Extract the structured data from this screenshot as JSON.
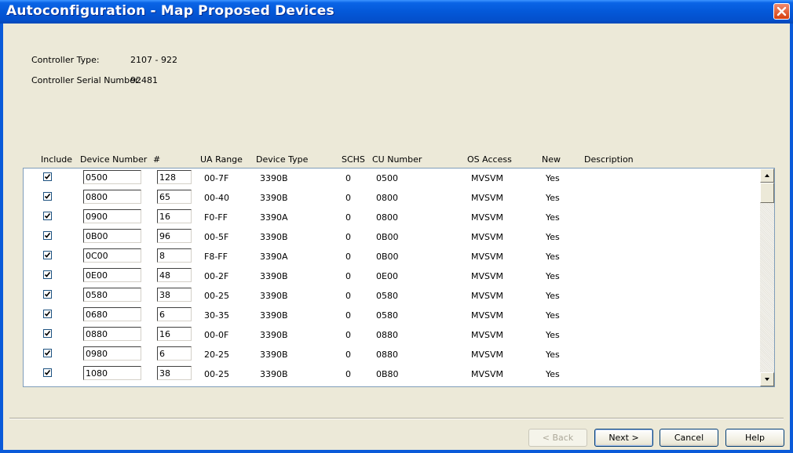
{
  "window": {
    "title": "Autoconfiguration - Map Proposed Devices"
  },
  "info": {
    "controller_type_label": "Controller Type:",
    "controller_type_value": "2107 - 922",
    "serial_label": "Controller Serial Number:",
    "serial_value": "92481"
  },
  "columns": {
    "include": "Include",
    "device_number": "Device Number",
    "count": "#",
    "ua_range": "UA Range",
    "device_type": "Device Type",
    "schs": "SCHS",
    "cu_number": "CU Number",
    "os_access": "OS Access",
    "new": "New",
    "description": "Description"
  },
  "rows": [
    {
      "include": true,
      "device_number": "0500",
      "count": "128",
      "ua_range": "00-7F",
      "device_type": "3390B",
      "schs": "0",
      "cu_number": "0500",
      "os_access": "MVSVM",
      "new": "Yes",
      "description": ""
    },
    {
      "include": true,
      "device_number": "0800",
      "count": "65",
      "ua_range": "00-40",
      "device_type": "3390B",
      "schs": "0",
      "cu_number": "0800",
      "os_access": "MVSVM",
      "new": "Yes",
      "description": ""
    },
    {
      "include": true,
      "device_number": "0900",
      "count": "16",
      "ua_range": "F0-FF",
      "device_type": "3390A",
      "schs": "0",
      "cu_number": "0800",
      "os_access": "MVSVM",
      "new": "Yes",
      "description": ""
    },
    {
      "include": true,
      "device_number": "0B00",
      "count": "96",
      "ua_range": "00-5F",
      "device_type": "3390B",
      "schs": "0",
      "cu_number": "0B00",
      "os_access": "MVSVM",
      "new": "Yes",
      "description": ""
    },
    {
      "include": true,
      "device_number": "0C00",
      "count": "8",
      "ua_range": "F8-FF",
      "device_type": "3390A",
      "schs": "0",
      "cu_number": "0B00",
      "os_access": "MVSVM",
      "new": "Yes",
      "description": ""
    },
    {
      "include": true,
      "device_number": "0E00",
      "count": "48",
      "ua_range": "00-2F",
      "device_type": "3390B",
      "schs": "0",
      "cu_number": "0E00",
      "os_access": "MVSVM",
      "new": "Yes",
      "description": ""
    },
    {
      "include": true,
      "device_number": "0580",
      "count": "38",
      "ua_range": "00-25",
      "device_type": "3390B",
      "schs": "0",
      "cu_number": "0580",
      "os_access": "MVSVM",
      "new": "Yes",
      "description": ""
    },
    {
      "include": true,
      "device_number": "0680",
      "count": "6",
      "ua_range": "30-35",
      "device_type": "3390B",
      "schs": "0",
      "cu_number": "0580",
      "os_access": "MVSVM",
      "new": "Yes",
      "description": ""
    },
    {
      "include": true,
      "device_number": "0880",
      "count": "16",
      "ua_range": "00-0F",
      "device_type": "3390B",
      "schs": "0",
      "cu_number": "0880",
      "os_access": "MVSVM",
      "new": "Yes",
      "description": ""
    },
    {
      "include": true,
      "device_number": "0980",
      "count": "6",
      "ua_range": "20-25",
      "device_type": "3390B",
      "schs": "0",
      "cu_number": "0880",
      "os_access": "MVSVM",
      "new": "Yes",
      "description": ""
    },
    {
      "include": true,
      "device_number": "1080",
      "count": "38",
      "ua_range": "00-25",
      "device_type": "3390B",
      "schs": "0",
      "cu_number": "0B80",
      "os_access": "MVSVM",
      "new": "Yes",
      "description": ""
    }
  ],
  "buttons": {
    "back": "< Back",
    "next": "Next >",
    "cancel": "Cancel",
    "help": "Help"
  },
  "colors": {
    "titlebar": "#0458d8",
    "close": "#d7400f",
    "dialog_bg": "#ece9d8",
    "grid_border": "#7f9db9",
    "check": "#21a121"
  },
  "icons": {
    "close": "close-icon",
    "check": "checkmark-icon",
    "scroll_up": "arrow-up-icon",
    "scroll_down": "arrow-down-icon"
  }
}
